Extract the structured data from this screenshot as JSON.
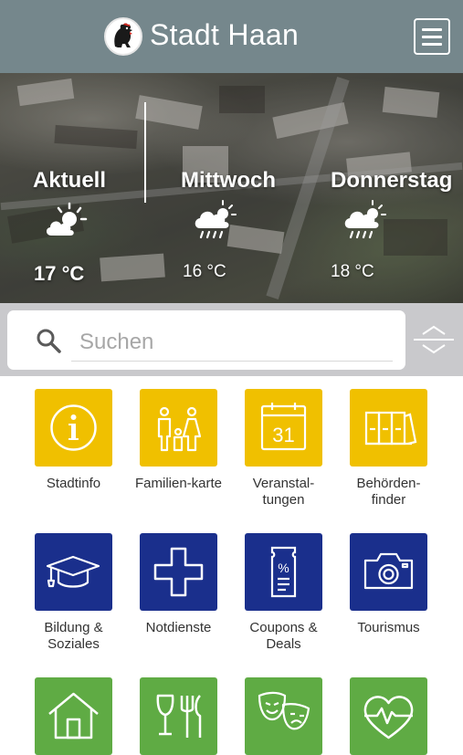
{
  "header": {
    "title": "Stadt Haan",
    "logo_icon": "rooster-coat-of-arms-icon",
    "menu_icon": "hamburger-menu-icon"
  },
  "weather": [
    {
      "day": "Aktuell",
      "temp": "17 °C",
      "icon": "partly-sunny-icon"
    },
    {
      "day": "Mittwoch",
      "temp": "16 °C",
      "icon": "cloud-rain-icon"
    },
    {
      "day": "Donnerstag",
      "temp": "18 °C",
      "icon": "cloud-rain-icon"
    }
  ],
  "search": {
    "placeholder": "Suchen",
    "icon": "search-icon",
    "toggle_icon": "expand-collapse-icon"
  },
  "colors": {
    "header": "#75878c",
    "yellow": "#f0c000",
    "blue": "#1a2f8c",
    "green": "#5fab44"
  },
  "tiles": [
    {
      "label": "Stadtinfo",
      "icon": "info-icon",
      "color": "yellow"
    },
    {
      "label": "Familien-karte",
      "icon": "family-icon",
      "color": "yellow"
    },
    {
      "label": "Veranstal-\ntungen",
      "icon": "calendar-icon",
      "color": "yellow"
    },
    {
      "label": "Behörden-\nfinder",
      "icon": "binders-icon",
      "color": "yellow"
    },
    {
      "label": "Bildung &\nSoziales",
      "icon": "graduation-cap-icon",
      "color": "blue"
    },
    {
      "label": "Notdienste",
      "icon": "medical-cross-icon",
      "color": "blue"
    },
    {
      "label": "Coupons &\nDeals",
      "icon": "coupon-icon",
      "color": "blue"
    },
    {
      "label": "Tourismus",
      "icon": "camera-icon",
      "color": "blue"
    },
    {
      "label": "",
      "icon": "house-icon",
      "color": "green"
    },
    {
      "label": "",
      "icon": "dining-icon",
      "color": "green"
    },
    {
      "label": "",
      "icon": "theater-masks-icon",
      "color": "green"
    },
    {
      "label": "",
      "icon": "heart-pulse-icon",
      "color": "green"
    }
  ]
}
